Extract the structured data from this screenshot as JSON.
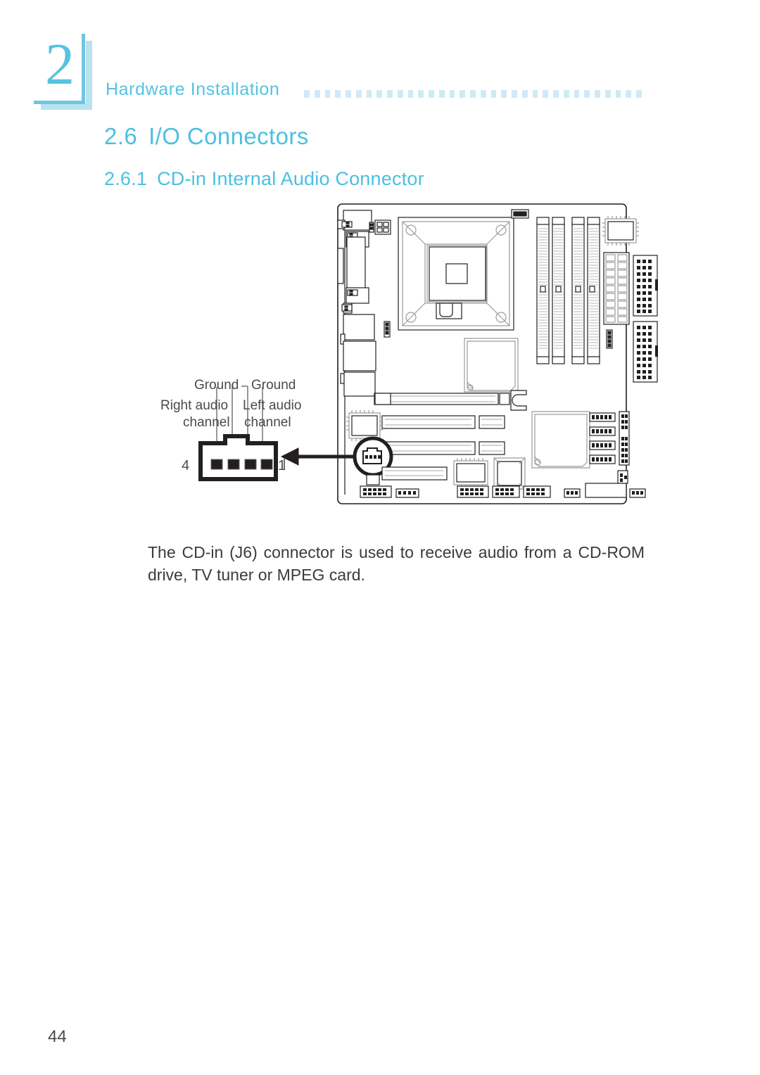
{
  "chapter": {
    "number": "2",
    "title": "Hardware Installation",
    "dot_count": 33
  },
  "headings": {
    "section_number": "2.6",
    "section_title": "I/O Connectors",
    "subsection_number": "2.6.1",
    "subsection_title": "CD-in Internal Audio Connector"
  },
  "figure": {
    "name": "motherboard-cd-in-connector-diagram",
    "connector_labels": {
      "ground_right": "Ground",
      "ground_left": "Ground",
      "right_audio_line1": "Right  audio",
      "right_audio_line2": "channel",
      "left_audio_line1": "Left  audio",
      "left_audio_line2": "channel"
    },
    "pin_numbers": {
      "first": "4",
      "last": "1"
    },
    "pin_count": 4
  },
  "body": {
    "paragraph": "The CD-in (J6) connector is used to receive audio from a CD-ROM drive, TV tuner or MPEG card."
  },
  "footer": {
    "page_number": "44"
  },
  "colors": {
    "accent": "#4cc0e0",
    "accent_light": "#cfeaf6",
    "accent_rule": "#6ec6e0",
    "text": "#3b3b3b",
    "line": "#231f20"
  }
}
